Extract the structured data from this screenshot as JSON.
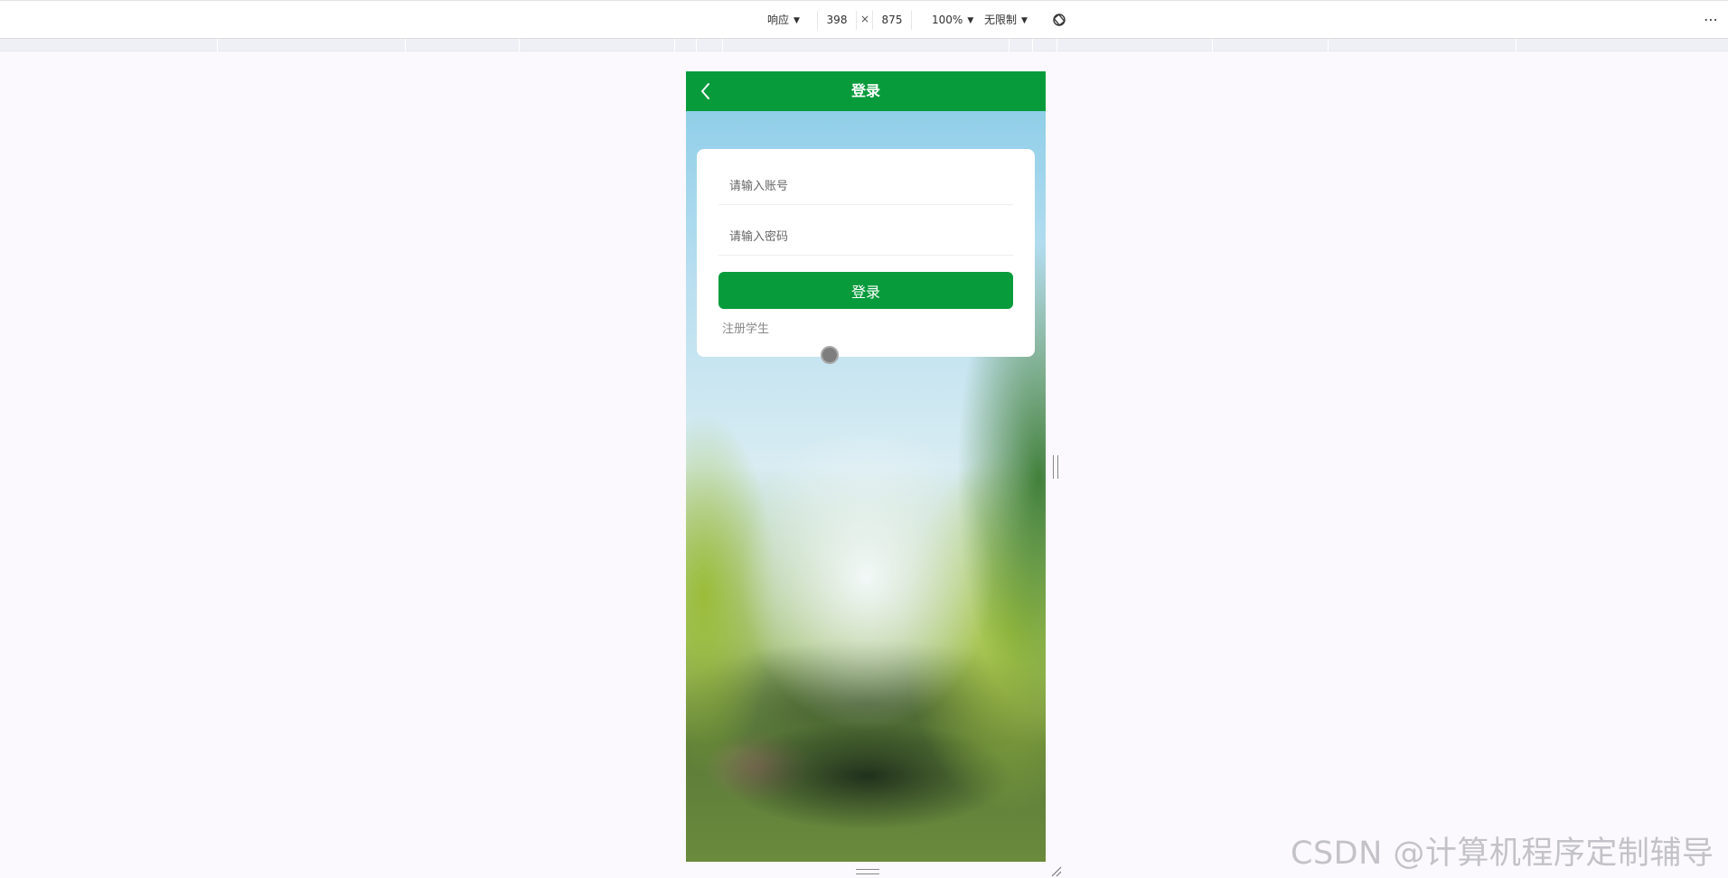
{
  "devtools": {
    "dimension_mode": "响应",
    "width": "398",
    "times": "×",
    "height": "875",
    "zoom": "100%",
    "throttle": "无限制",
    "rotate_icon": "rotate-icon",
    "more_icon": "more-icon",
    "more_glyph": "⋯"
  },
  "app": {
    "nav": {
      "title": "登录",
      "back_icon": "chevron-left-icon"
    },
    "login_form": {
      "account_placeholder": "请输入账号",
      "password_placeholder": "请输入密码",
      "submit_label": "登录",
      "register_link": "注册学生"
    }
  },
  "colors": {
    "primary": "#079b3c",
    "card_bg": "#ffffff",
    "page_bg": "#fbf9fd"
  },
  "watermark": "CSDN @计算机程序定制辅导"
}
